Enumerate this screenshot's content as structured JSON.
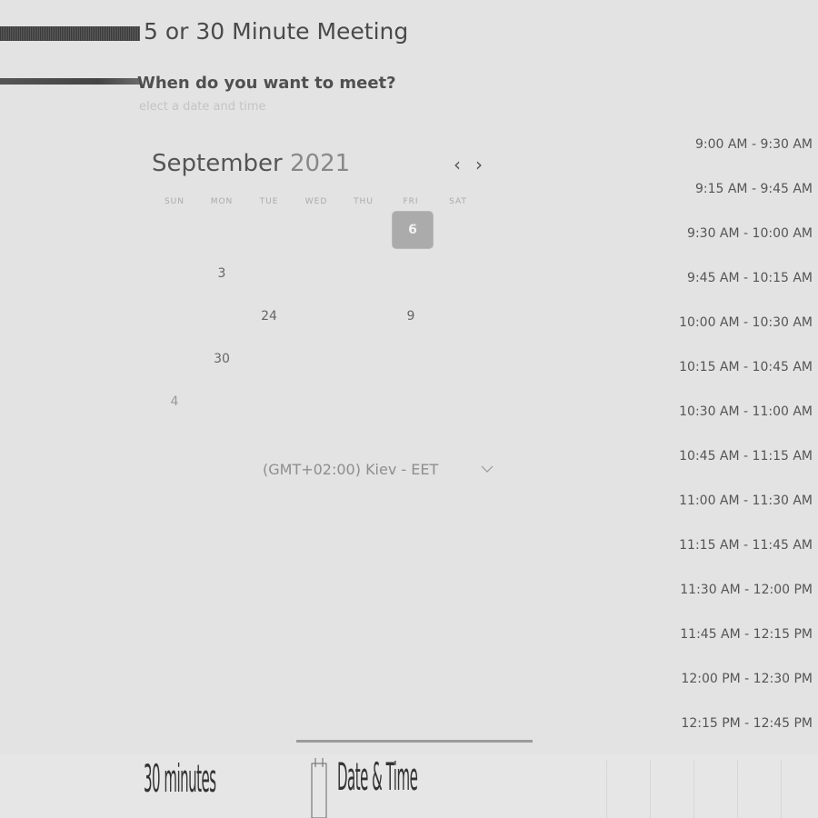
{
  "header": {
    "title": "5 or 30 Minute Meeting",
    "question": "When do you want to meet?",
    "hint": "elect a date and time"
  },
  "calendar": {
    "month": "September",
    "year": "2021",
    "prev_icon": "chevron-left-icon",
    "next_icon": "chevron-right-icon",
    "weekdays": [
      "SUN",
      "MON",
      "TUE",
      "WED",
      "THU",
      "FRI",
      "SAT"
    ],
    "days": {
      "fri_sel": "6",
      "mon_r2": "3",
      "tue_r3": "24",
      "fri_r3": "9",
      "mon_r4": "30",
      "sun_r5": "4"
    },
    "selected_color": "#ababab"
  },
  "timezone": {
    "label": "(GMT+02:00) Kiev - EET",
    "icon": "chevron-down-icon"
  },
  "slots": [
    "9:00 AM - 9:30 AM",
    "9:15 AM - 9:45 AM",
    "9:30 AM - 10:00 AM",
    "9:45 AM - 10:15 AM",
    "10:00 AM - 10:30 AM",
    "10:15 AM - 10:45 AM",
    "10:30 AM - 11:00 AM",
    "10:45 AM - 11:15 AM",
    "11:00 AM - 11:30 AM",
    "11:15 AM - 11:45 AM",
    "11:30 AM - 12:00 PM",
    "11:45 AM - 12:15 PM",
    "12:00 PM - 12:30 PM",
    "12:15 PM - 12:45 PM"
  ],
  "footer": {
    "tab_duration": "30 minutes",
    "tab_datetime": "Date & Time",
    "calendar_icon": "calendar-icon"
  }
}
